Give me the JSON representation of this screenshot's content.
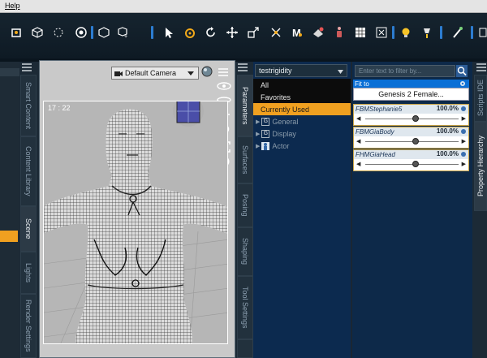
{
  "menubar": {
    "help_label": "Help"
  },
  "viewport": {
    "camera_label": "Default Camera",
    "aspect_label": "17 : 22"
  },
  "left_tabs": [
    "Smart Content",
    "Content Library",
    "Scene",
    "Lights",
    "Render Settings"
  ],
  "mid_tabs": [
    "Parameters",
    "Surfaces",
    "Posing",
    "Shaping",
    "Tool Settings"
  ],
  "right_tabs": [
    "Scripts IDE",
    "Property Hierarchy"
  ],
  "parameters": {
    "node": "testrigidity",
    "groups": [
      {
        "label": "All",
        "selected": false
      },
      {
        "label": "Favorites",
        "selected": false
      },
      {
        "label": "Currently Used",
        "selected": true
      }
    ],
    "tree": [
      {
        "label": "General"
      },
      {
        "label": "Display"
      },
      {
        "label": "Actor"
      }
    ]
  },
  "properties": {
    "filter_placeholder": "Enter text to filter by...",
    "fit_to_label": "Fit to",
    "fit_to_value": "Genesis 2 Female...",
    "sliders": [
      {
        "name": "FBMStephanie5",
        "value": "100.0%",
        "level": 1.0
      },
      {
        "name": "FBMGiaBody",
        "value": "100.0%",
        "level": 1.0
      },
      {
        "name": "FHMGiaHead",
        "value": "100.0%",
        "level": 1.0
      }
    ]
  },
  "colors": {
    "accent": "#f0a020",
    "panel": "#0c2a4f",
    "highlight": "#2c7cd0"
  }
}
